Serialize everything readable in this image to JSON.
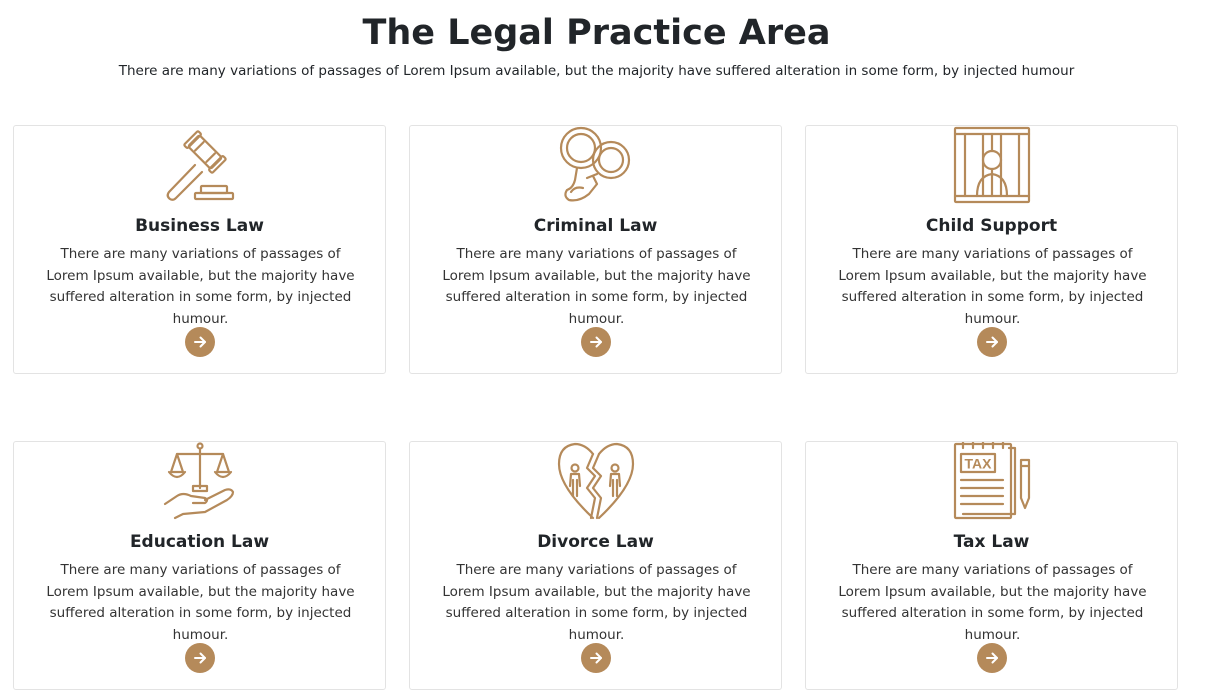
{
  "section": {
    "title": "The Legal Practice Area",
    "subtitle": "There are many variations of passages of Lorem Ipsum available, but the majority have suffered alteration in some form, by injected humour"
  },
  "accent_color": "#b58a5a",
  "cards": [
    {
      "title": "Business Law",
      "icon": "gavel-icon",
      "text": "There are many variations of passages of Lorem Ipsum available, but the majority have suffered alteration in some form, by injected humour.",
      "button_icon": "arrow-right-icon"
    },
    {
      "title": "Criminal Law",
      "icon": "handcuffs-icon",
      "text": "There are many variations of passages of Lorem Ipsum available, but the majority have suffered alteration in some form, by injected humour.",
      "button_icon": "arrow-right-icon"
    },
    {
      "title": "Child Support",
      "icon": "prison-bars-icon",
      "text": "There are many variations of passages of Lorem Ipsum available, but the majority have suffered alteration in some form, by injected humour.",
      "button_icon": "arrow-right-icon"
    },
    {
      "title": "Education Law",
      "icon": "scales-in-hand-icon",
      "text": "There are many variations of passages of Lorem Ipsum available, but the majority have suffered alteration in some form, by injected humour.",
      "button_icon": "arrow-right-icon"
    },
    {
      "title": "Divorce Law",
      "icon": "broken-heart-icon",
      "text": "There are many variations of passages of Lorem Ipsum available, but the majority have suffered alteration in some form, by injected humour.",
      "button_icon": "arrow-right-icon"
    },
    {
      "title": "Tax Law",
      "icon": "tax-document-icon",
      "icon_text": "TAX",
      "text": "There are many variations of passages of Lorem Ipsum available, but the majority have suffered alteration in some form, by injected humour.",
      "button_icon": "arrow-right-icon"
    }
  ]
}
